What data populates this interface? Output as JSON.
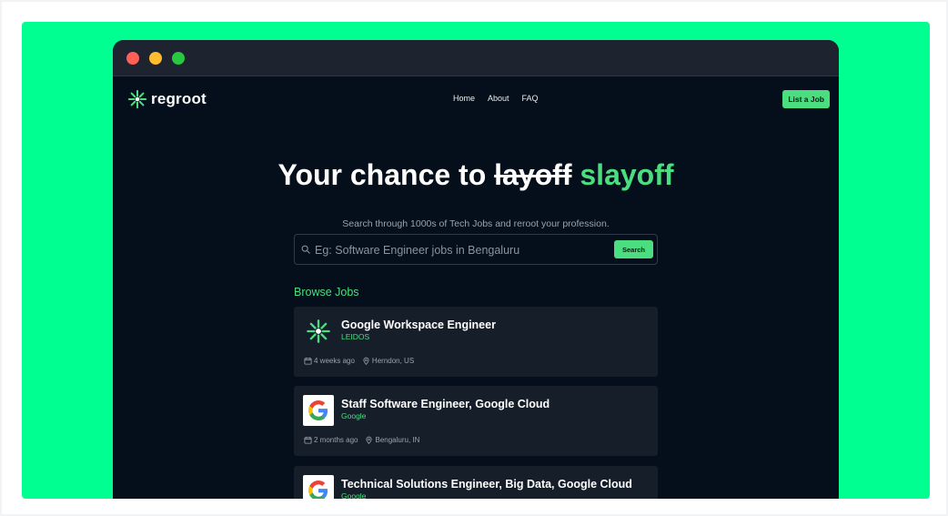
{
  "brand": {
    "name": "regroot"
  },
  "nav": {
    "links": [
      "Home",
      "About",
      "FAQ"
    ],
    "cta": "List a Job"
  },
  "hero": {
    "title_prefix": "Your chance to ",
    "title_strike": "layoff",
    "title_accent": "slayoff",
    "subtitle": "Search through 1000s of Tech Jobs and reroot your profession."
  },
  "search": {
    "placeholder": "Eg: Software Engineer jobs in Bengaluru",
    "button": "Search"
  },
  "browse": {
    "heading": "Browse Jobs"
  },
  "jobs": [
    {
      "title": "Google Workspace Engineer",
      "company": "LEIDOS",
      "posted": "4 weeks ago",
      "location": "Herndon, US",
      "logo": "regroot-burst-icon"
    },
    {
      "title": "Staff Software Engineer, Google Cloud",
      "company": "Google",
      "posted": "2 months ago",
      "location": "Bengaluru, IN",
      "logo": "google-g-icon"
    },
    {
      "title": "Technical Solutions Engineer, Big Data, Google Cloud",
      "company": "Google",
      "posted": "",
      "location": "",
      "logo": "google-g-icon"
    }
  ],
  "colors": {
    "accent": "#4ade80",
    "page_bg": "#040f1b",
    "frame_bg": "#00ff91",
    "card_bg": "#161e29"
  }
}
